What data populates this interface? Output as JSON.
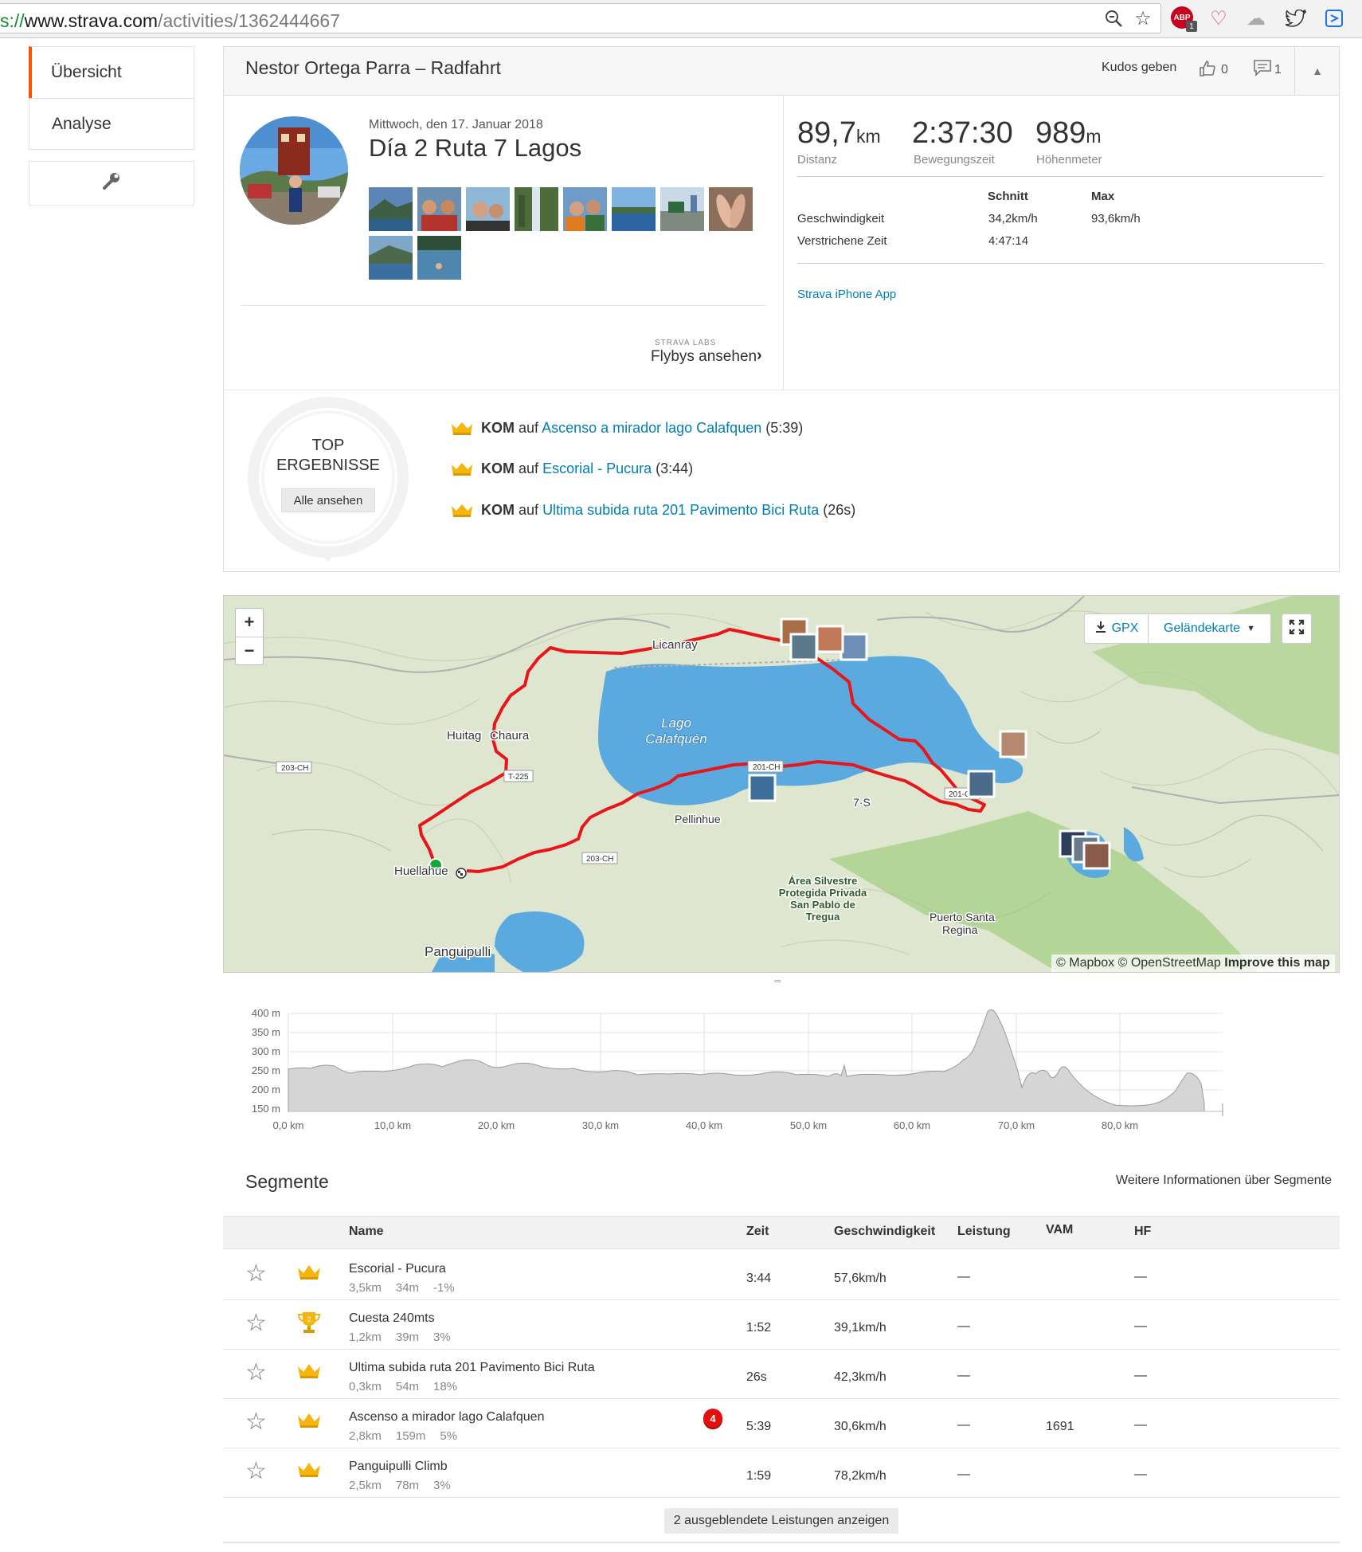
{
  "browser": {
    "url_scheme": "s://",
    "url_host": "www.strava.com",
    "url_path": "/activities/1362444667",
    "adblock_badge": "ABP",
    "adblock_count": "1"
  },
  "sidebar": {
    "items": [
      {
        "label": "Übersicht",
        "active": true
      },
      {
        "label": "Analyse",
        "active": false
      }
    ],
    "tools_icon": "wrench-icon"
  },
  "header": {
    "title": "Nestor Ortega Parra – Radfahrt",
    "kudos_label": "Kudos geben",
    "kudos_count": "0",
    "comment_count": "1"
  },
  "activity": {
    "date": "Mittwoch, den 17. Januar 2018",
    "name": "Día 2 Ruta 7 Lagos",
    "labs_label": "STRAVA LABS",
    "flybys_label": "Flybys ansehen"
  },
  "stats": {
    "distance": {
      "value": "89,7",
      "unit": "km",
      "label": "Distanz"
    },
    "moving_time": {
      "value": "2:37:30",
      "label": "Bewegungszeit"
    },
    "elevation": {
      "value": "989",
      "unit": "m",
      "label": "Höhenmeter"
    },
    "table": {
      "col_avg": "Schnitt",
      "col_max": "Max",
      "rows": [
        {
          "label": "Geschwindigkeit",
          "avg": "34,2km/h",
          "max": "93,6km/h"
        },
        {
          "label": "Verstrichene Zeit",
          "avg": "4:47:14",
          "max": ""
        }
      ]
    },
    "device": "Strava iPhone App"
  },
  "top_results": {
    "title_line1": "TOP",
    "title_line2": "ERGEBNISSE",
    "button": "Alle ansehen",
    "items": [
      {
        "badge": "KOM",
        "prefix": "auf",
        "segment": "Ascenso a mirador lago Calafquen",
        "time": "(5:39)"
      },
      {
        "badge": "KOM",
        "prefix": "auf",
        "segment": "Escorial - Pucura",
        "time": "(3:44)"
      },
      {
        "badge": "KOM",
        "prefix": "auf",
        "segment": "Ultima subida ruta 201 Pavimento Bici Ruta",
        "time": "(26s)"
      }
    ]
  },
  "map": {
    "zoom_in": "+",
    "zoom_out": "−",
    "gpx_label": "GPX",
    "terrain_label": "Geländekarte",
    "attribution_1": "© Mapbox © OpenStreetMap",
    "attribution_2": "Improve this map",
    "labels": {
      "lake": "Lago",
      "lake2": "Calafquén",
      "licanray": "Licanray",
      "huitag": "Huitag",
      "chaura": "Chaura",
      "huellahue": "Huellahue",
      "panguipulli": "Panguipulli",
      "pellinque": "Pellinhue",
      "coñaripe": "7·S",
      "area1": "Área Silvestre",
      "area2": "Protegida Privada",
      "area3": "San Pablo de",
      "area4": "Tregua",
      "puerto1": "Puerto Santa",
      "puerto2": "Regina",
      "road_203": "203-CH",
      "road_t225": "T-225",
      "road_201": "201-CH",
      "road_201b": "201-CH",
      "road_203b": "203-CH"
    }
  },
  "elevation": {
    "y_ticks": [
      "400 m",
      "350 m",
      "300 m",
      "250 m",
      "200 m",
      "150 m"
    ],
    "x_ticks": [
      "0,0 km",
      "10,0 km",
      "20,0 km",
      "30,0 km",
      "40,0 km",
      "50,0 km",
      "60,0 km",
      "70,0 km",
      "80,0 km"
    ]
  },
  "segments": {
    "title": "Segmente",
    "more_info": "Weitere Informationen über Segmente",
    "columns": {
      "name": "Name",
      "time": "Zeit",
      "speed": "Geschwindigkeit",
      "power": "Leistung",
      "vam": "VAM",
      "hr": "HF"
    },
    "rows": [
      {
        "name": "Escorial - Pucura",
        "dist": "3,5km",
        "elev": "34m",
        "grade": "-1%",
        "time": "3:44",
        "speed": "57,6km/h",
        "power": "—",
        "vam": "",
        "hr": "—",
        "award": "crown"
      },
      {
        "name": "Cuesta 240mts",
        "dist": "1,2km",
        "elev": "39m",
        "grade": "3%",
        "time": "1:52",
        "speed": "39,1km/h",
        "power": "—",
        "vam": "",
        "hr": "—",
        "award": "trophy-2"
      },
      {
        "name": "Ultima subida ruta 201 Pavimento Bici Ruta",
        "dist": "0,3km",
        "elev": "54m",
        "grade": "18%",
        "time": "26s",
        "speed": "42,3km/h",
        "power": "—",
        "vam": "",
        "hr": "—",
        "award": "crown"
      },
      {
        "name": "Ascenso a mirador lago Calafquen",
        "dist": "2,8km",
        "elev": "159m",
        "grade": "5%",
        "time": "5:39",
        "speed": "30,6km/h",
        "power": "—",
        "vam": "1691",
        "hr": "—",
        "award": "crown",
        "pr_badge": "4"
      },
      {
        "name": "Panguipulli Climb",
        "dist": "2,5km",
        "elev": "78m",
        "grade": "3%",
        "time": "1:59",
        "speed": "78,2km/h",
        "power": "—",
        "vam": "",
        "hr": "—",
        "award": "crown"
      }
    ],
    "show_hidden": "2 ausgeblendete Leistungen anzeigen"
  },
  "colors": {
    "strava_orange": "#fc5200",
    "link_blue": "#007fb6",
    "route_red": "#e8151b",
    "crown_gold": "#f5b50c"
  }
}
